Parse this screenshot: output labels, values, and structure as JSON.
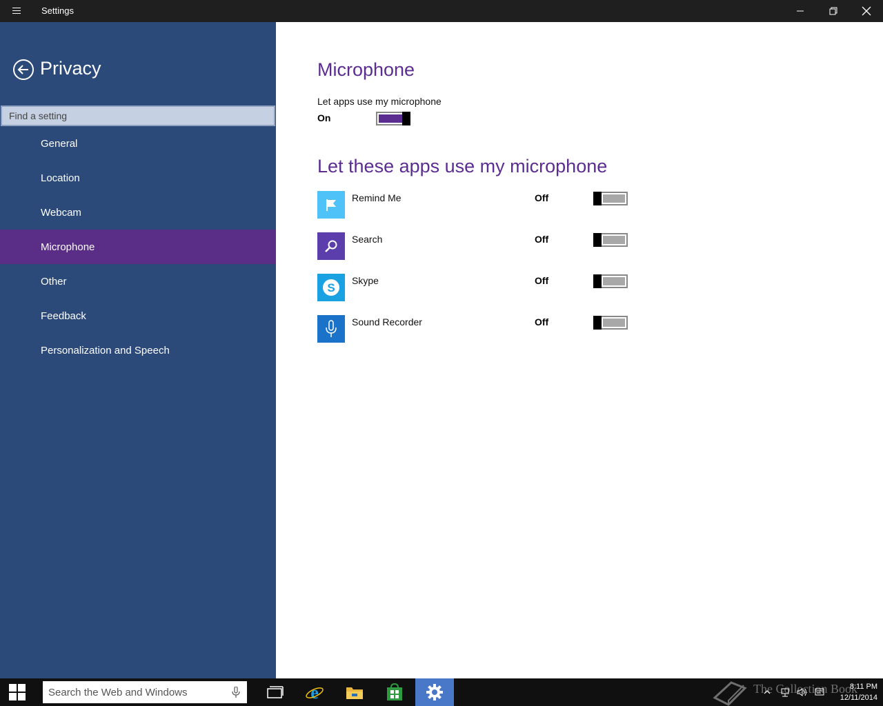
{
  "window": {
    "title": "Settings"
  },
  "sidebar": {
    "title": "Privacy",
    "search_placeholder": "Find a setting",
    "items": [
      {
        "label": "General"
      },
      {
        "label": "Location"
      },
      {
        "label": "Webcam"
      },
      {
        "label": "Microphone",
        "active": true
      },
      {
        "label": "Other"
      },
      {
        "label": "Feedback"
      },
      {
        "label": "Personalization and Speech"
      }
    ]
  },
  "main": {
    "heading": "Microphone",
    "master_setting": {
      "label": "Let apps use my microphone",
      "state": "On"
    },
    "apps_heading": "Let these apps use my microphone",
    "apps": [
      {
        "name": "Remind Me",
        "state": "Off",
        "icon": "flag-icon",
        "color": "#4fc3f7"
      },
      {
        "name": "Search",
        "state": "Off",
        "icon": "search-icon",
        "color": "#5b3dab"
      },
      {
        "name": "Skype",
        "state": "Off",
        "icon": "skype-icon",
        "color": "#1aa1e1"
      },
      {
        "name": "Sound Recorder",
        "state": "Off",
        "icon": "microphone-icon",
        "color": "#1a73c9"
      }
    ]
  },
  "taskbar": {
    "search_placeholder": "Search the Web and Windows",
    "apps": [
      "task-view-icon",
      "internet-explorer-icon",
      "file-explorer-icon",
      "store-icon",
      "settings-icon"
    ],
    "clock_time": "8:11 PM",
    "clock_date": "12/11/2014",
    "watermark": "The Collection Book"
  },
  "colors": {
    "accent": "#5c2d91",
    "sidebar_bg": "#2b4a7a",
    "taskbar_active": "#4a78c8"
  }
}
